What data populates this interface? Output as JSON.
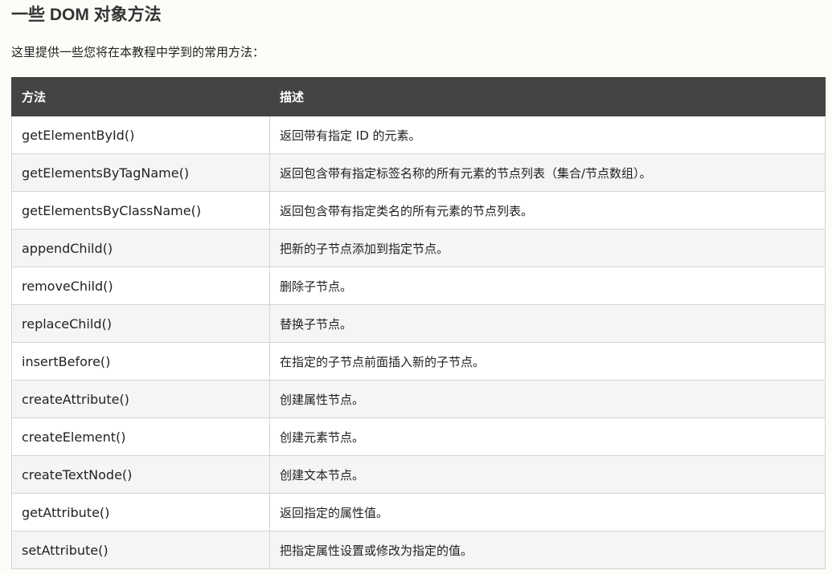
{
  "heading": "一些 DOM 对象方法",
  "intro": "这里提供一些您将在本教程中学到的常用方法：",
  "table": {
    "headers": [
      "方法",
      "描述"
    ],
    "rows": [
      [
        "getElementById()",
        "返回带有指定 ID 的元素。"
      ],
      [
        "getElementsByTagName()",
        "返回包含带有指定标签名称的所有元素的节点列表（集合/节点数组）。"
      ],
      [
        "getElementsByClassName()",
        "返回包含带有指定类名的所有元素的节点列表。"
      ],
      [
        "appendChild()",
        "把新的子节点添加到指定节点。"
      ],
      [
        "removeChild()",
        "删除子节点。"
      ],
      [
        "replaceChild()",
        "替换子节点。"
      ],
      [
        "insertBefore()",
        "在指定的子节点前面插入新的子节点。"
      ],
      [
        "createAttribute()",
        "创建属性节点。"
      ],
      [
        "createElement()",
        "创建元素节点。"
      ],
      [
        "createTextNode()",
        "创建文本节点。"
      ],
      [
        "getAttribute()",
        "返回指定的属性值。"
      ],
      [
        "setAttribute()",
        "把指定属性设置或修改为指定的值。"
      ]
    ]
  },
  "colors": {
    "header_bg": "#444444",
    "row_alt_bg": "#f5f5f5",
    "border": "#d4d4d4"
  }
}
